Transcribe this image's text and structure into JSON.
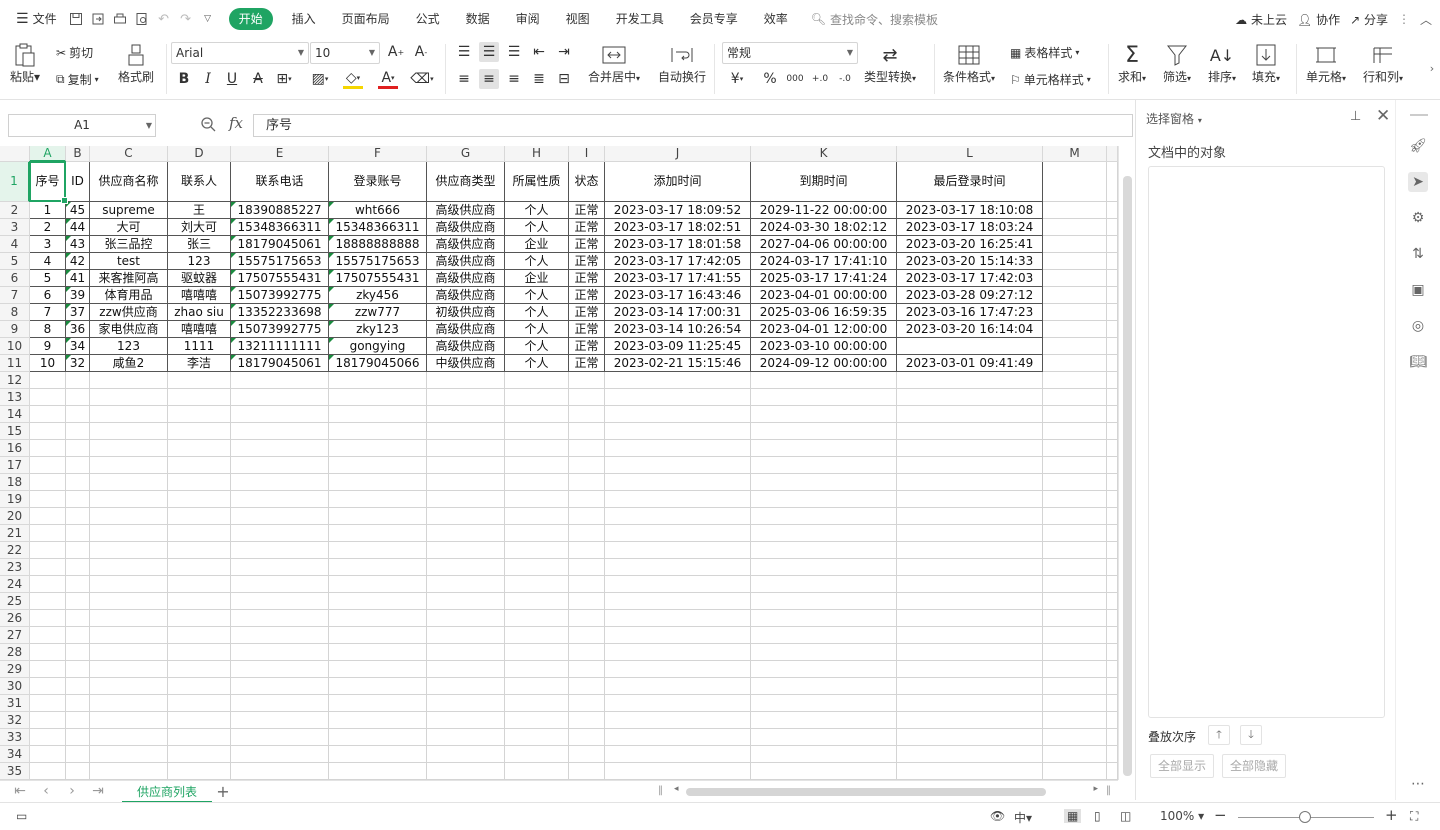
{
  "menu": {
    "file_label": "文件",
    "tabs": [
      "开始",
      "插入",
      "页面布局",
      "公式",
      "数据",
      "审阅",
      "视图",
      "开发工具",
      "会员专享",
      "效率"
    ],
    "search_placeholder": "查找命令、搜索模板",
    "cloud_label": "未上云",
    "collab_label": "协作",
    "share_label": "分享"
  },
  "ribbon": {
    "paste": "粘贴",
    "cut": "剪切",
    "copy": "复制",
    "format_painter": "格式刷",
    "font_name": "Arial",
    "font_size": "10",
    "merge_center": "合并居中",
    "wrap_text": "自动换行",
    "number_format": "常规",
    "type_convert": "类型转换",
    "cond_format": "条件格式",
    "table_style": "表格样式",
    "cell_style": "单元格样式",
    "sum": "求和",
    "filter": "筛选",
    "sort": "排序",
    "fill": "填充",
    "cells": "单元格",
    "rows_cols": "行和列",
    "currency_symbol": "¥",
    "percent_symbol": "%",
    "thousands_symbol": "000",
    "inc_decimal": "+.0",
    "dec_decimal": "-.0"
  },
  "formula_bar": {
    "name_box": "A1",
    "fx": "fx",
    "content": "序号"
  },
  "sheet": {
    "columns": [
      "A",
      "B",
      "C",
      "D",
      "E",
      "F",
      "G",
      "H",
      "I",
      "J",
      "K",
      "L",
      "M"
    ],
    "header_row": [
      "序号",
      "ID",
      "供应商名称",
      "联系人",
      "联系电话",
      "登录账号",
      "供应商类型",
      "所属性质",
      "状态",
      "添加时间",
      "到期时间",
      "最后登录时间"
    ],
    "rows": [
      [
        "1",
        "45",
        "supreme",
        "王",
        "18390885227",
        "wht666",
        "高级供应商",
        "个人",
        "正常",
        "2023-03-17 18:09:52",
        "2029-11-22 00:00:00",
        "2023-03-17 18:10:08"
      ],
      [
        "2",
        "44",
        "大可",
        "刘大可",
        "15348366311",
        "15348366311",
        "高级供应商",
        "个人",
        "正常",
        "2023-03-17 18:02:51",
        "2024-03-30 18:02:12",
        "2023-03-17 18:03:24"
      ],
      [
        "3",
        "43",
        "张三品控",
        "张三",
        "18179045061",
        "18888888888",
        "高级供应商",
        "企业",
        "正常",
        "2023-03-17 18:01:58",
        "2027-04-06 00:00:00",
        "2023-03-20 16:25:41"
      ],
      [
        "4",
        "42",
        "test",
        "123",
        "15575175653",
        "15575175653",
        "高级供应商",
        "个人",
        "正常",
        "2023-03-17 17:42:05",
        "2024-03-17 17:41:10",
        "2023-03-20 15:14:33"
      ],
      [
        "5",
        "41",
        "来客推阿高",
        "驱蚊器",
        "17507555431",
        "17507555431",
        "高级供应商",
        "企业",
        "正常",
        "2023-03-17 17:41:55",
        "2025-03-17 17:41:24",
        "2023-03-17 17:42:03"
      ],
      [
        "6",
        "39",
        "体育用品",
        "嘻嘻嘻",
        "15073992775",
        "zky456",
        "高级供应商",
        "个人",
        "正常",
        "2023-03-17 16:43:46",
        "2023-04-01 00:00:00",
        "2023-03-28 09:27:12"
      ],
      [
        "7",
        "37",
        "zzw供应商",
        "zhao siu",
        "13352233698",
        "zzw777",
        "初级供应商",
        "个人",
        "正常",
        "2023-03-14 17:00:31",
        "2025-03-06 16:59:35",
        "2023-03-16 17:47:23"
      ],
      [
        "8",
        "36",
        "家电供应商",
        "嘻嘻嘻",
        "15073992775",
        "zky123",
        "高级供应商",
        "个人",
        "正常",
        "2023-03-14 10:26:54",
        "2023-04-01 12:00:00",
        "2023-03-20 16:14:04"
      ],
      [
        "9",
        "34",
        "123",
        "1111",
        "13211111111",
        "gongying",
        "高级供应商",
        "个人",
        "正常",
        "2023-03-09 11:25:45",
        "2023-03-10 00:00:00",
        ""
      ],
      [
        "10",
        "32",
        "咸鱼2",
        "李洁",
        "18179045061",
        "18179045066",
        "中级供应商",
        "个人",
        "正常",
        "2023-02-21 15:15:46",
        "2024-09-12 00:00:00",
        "2023-03-01 09:41:49"
      ]
    ],
    "row_numbers": [
      "1",
      "2",
      "3",
      "4",
      "5",
      "6",
      "7",
      "8",
      "9",
      "10",
      "11",
      "12",
      "13",
      "14",
      "15",
      "16",
      "17",
      "18",
      "19",
      "20",
      "21",
      "22",
      "23",
      "24",
      "25",
      "26",
      "27",
      "28",
      "29",
      "30",
      "31",
      "32",
      "33",
      "34",
      "35"
    ],
    "active_cell": "A1",
    "sheet_tab": "供应商列表"
  },
  "pane": {
    "title": "选择窗格",
    "subtitle": "文档中的对象",
    "order_label": "叠放次序",
    "show_all": "全部显示",
    "hide_all": "全部隐藏"
  },
  "status": {
    "zoom": "100%"
  },
  "colors": {
    "accent": "#1fa463",
    "grid_line": "#d4d4d4",
    "header_bg": "#f5f5f5"
  }
}
